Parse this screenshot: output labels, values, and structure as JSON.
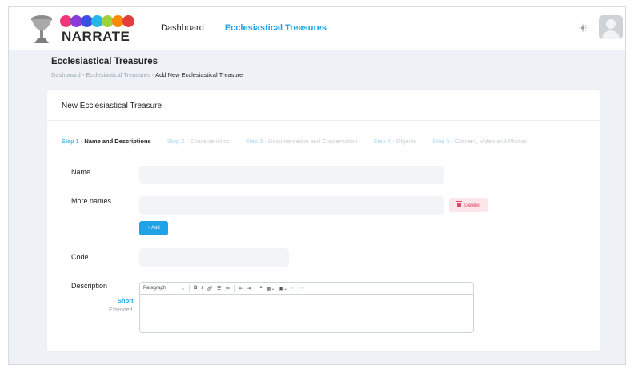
{
  "header": {
    "brand": "NARRATE",
    "logo_dot_colors": [
      "#f2367a",
      "#8a3ad6",
      "#3b4fe4",
      "#23b7e5",
      "#9fd13b",
      "#ff8a00",
      "#e33d3d"
    ],
    "nav": [
      {
        "label": "Dashboard",
        "active": false
      },
      {
        "label": "Ecclesiastical Treasures",
        "active": true
      }
    ],
    "theme_toggle_icon": "sun-icon",
    "avatar_icon": "user-avatar-icon"
  },
  "page": {
    "title": "Ecclesiastical Treasures",
    "breadcrumb": {
      "items": [
        "Dashboard",
        "Ecclesiastical Treasures"
      ],
      "separator": " - ",
      "current": "Add New Ecclesiastical Treasure"
    }
  },
  "card": {
    "title": "New Ecclesiastical Treasure",
    "steps": [
      {
        "num": "Step 1",
        "label": "Name and Descriptions",
        "active": true
      },
      {
        "num": "Step 2",
        "label": "Characteristics",
        "active": false
      },
      {
        "num": "Step 3",
        "label": "Documentation and Conservation",
        "active": false
      },
      {
        "num": "Step 4",
        "label": "Objects",
        "active": false
      },
      {
        "num": "Step 5",
        "label": "Content, Video and Photos",
        "active": false
      }
    ],
    "step_separator": " - ",
    "form": {
      "name_label": "Name",
      "name_value": "",
      "more_names_label": "More names",
      "more_names_value": "",
      "delete_label": "Delete",
      "add_label": "+ Add",
      "code_label": "Code",
      "code_value": "",
      "description_label": "Description",
      "description_modes": [
        "Short",
        "Extended"
      ],
      "description_active_mode": "Short",
      "editor_paragraph": "Paragraph",
      "editor_value": ""
    }
  },
  "colors": {
    "accent": "#1ea4e6",
    "danger": "#e04766",
    "background": "#eef2f6"
  }
}
